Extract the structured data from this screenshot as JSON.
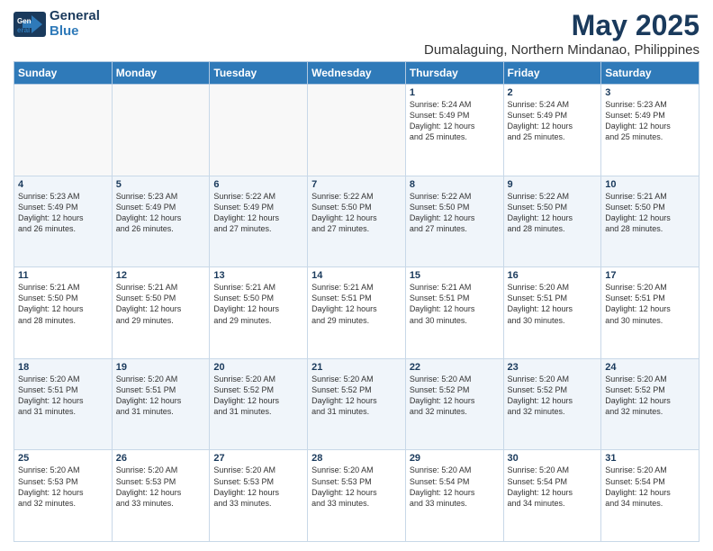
{
  "header": {
    "logo_line1": "General",
    "logo_line2": "Blue",
    "title": "May 2025",
    "subtitle": "Dumalaguing, Northern Mindanao, Philippines"
  },
  "weekdays": [
    "Sunday",
    "Monday",
    "Tuesday",
    "Wednesday",
    "Thursday",
    "Friday",
    "Saturday"
  ],
  "weeks": [
    [
      {
        "day": "",
        "info": ""
      },
      {
        "day": "",
        "info": ""
      },
      {
        "day": "",
        "info": ""
      },
      {
        "day": "",
        "info": ""
      },
      {
        "day": "1",
        "info": "Sunrise: 5:24 AM\nSunset: 5:49 PM\nDaylight: 12 hours\nand 25 minutes."
      },
      {
        "day": "2",
        "info": "Sunrise: 5:24 AM\nSunset: 5:49 PM\nDaylight: 12 hours\nand 25 minutes."
      },
      {
        "day": "3",
        "info": "Sunrise: 5:23 AM\nSunset: 5:49 PM\nDaylight: 12 hours\nand 25 minutes."
      }
    ],
    [
      {
        "day": "4",
        "info": "Sunrise: 5:23 AM\nSunset: 5:49 PM\nDaylight: 12 hours\nand 26 minutes."
      },
      {
        "day": "5",
        "info": "Sunrise: 5:23 AM\nSunset: 5:49 PM\nDaylight: 12 hours\nand 26 minutes."
      },
      {
        "day": "6",
        "info": "Sunrise: 5:22 AM\nSunset: 5:49 PM\nDaylight: 12 hours\nand 27 minutes."
      },
      {
        "day": "7",
        "info": "Sunrise: 5:22 AM\nSunset: 5:50 PM\nDaylight: 12 hours\nand 27 minutes."
      },
      {
        "day": "8",
        "info": "Sunrise: 5:22 AM\nSunset: 5:50 PM\nDaylight: 12 hours\nand 27 minutes."
      },
      {
        "day": "9",
        "info": "Sunrise: 5:22 AM\nSunset: 5:50 PM\nDaylight: 12 hours\nand 28 minutes."
      },
      {
        "day": "10",
        "info": "Sunrise: 5:21 AM\nSunset: 5:50 PM\nDaylight: 12 hours\nand 28 minutes."
      }
    ],
    [
      {
        "day": "11",
        "info": "Sunrise: 5:21 AM\nSunset: 5:50 PM\nDaylight: 12 hours\nand 28 minutes."
      },
      {
        "day": "12",
        "info": "Sunrise: 5:21 AM\nSunset: 5:50 PM\nDaylight: 12 hours\nand 29 minutes."
      },
      {
        "day": "13",
        "info": "Sunrise: 5:21 AM\nSunset: 5:50 PM\nDaylight: 12 hours\nand 29 minutes."
      },
      {
        "day": "14",
        "info": "Sunrise: 5:21 AM\nSunset: 5:51 PM\nDaylight: 12 hours\nand 29 minutes."
      },
      {
        "day": "15",
        "info": "Sunrise: 5:21 AM\nSunset: 5:51 PM\nDaylight: 12 hours\nand 30 minutes."
      },
      {
        "day": "16",
        "info": "Sunrise: 5:20 AM\nSunset: 5:51 PM\nDaylight: 12 hours\nand 30 minutes."
      },
      {
        "day": "17",
        "info": "Sunrise: 5:20 AM\nSunset: 5:51 PM\nDaylight: 12 hours\nand 30 minutes."
      }
    ],
    [
      {
        "day": "18",
        "info": "Sunrise: 5:20 AM\nSunset: 5:51 PM\nDaylight: 12 hours\nand 31 minutes."
      },
      {
        "day": "19",
        "info": "Sunrise: 5:20 AM\nSunset: 5:51 PM\nDaylight: 12 hours\nand 31 minutes."
      },
      {
        "day": "20",
        "info": "Sunrise: 5:20 AM\nSunset: 5:52 PM\nDaylight: 12 hours\nand 31 minutes."
      },
      {
        "day": "21",
        "info": "Sunrise: 5:20 AM\nSunset: 5:52 PM\nDaylight: 12 hours\nand 31 minutes."
      },
      {
        "day": "22",
        "info": "Sunrise: 5:20 AM\nSunset: 5:52 PM\nDaylight: 12 hours\nand 32 minutes."
      },
      {
        "day": "23",
        "info": "Sunrise: 5:20 AM\nSunset: 5:52 PM\nDaylight: 12 hours\nand 32 minutes."
      },
      {
        "day": "24",
        "info": "Sunrise: 5:20 AM\nSunset: 5:52 PM\nDaylight: 12 hours\nand 32 minutes."
      }
    ],
    [
      {
        "day": "25",
        "info": "Sunrise: 5:20 AM\nSunset: 5:53 PM\nDaylight: 12 hours\nand 32 minutes."
      },
      {
        "day": "26",
        "info": "Sunrise: 5:20 AM\nSunset: 5:53 PM\nDaylight: 12 hours\nand 33 minutes."
      },
      {
        "day": "27",
        "info": "Sunrise: 5:20 AM\nSunset: 5:53 PM\nDaylight: 12 hours\nand 33 minutes."
      },
      {
        "day": "28",
        "info": "Sunrise: 5:20 AM\nSunset: 5:53 PM\nDaylight: 12 hours\nand 33 minutes."
      },
      {
        "day": "29",
        "info": "Sunrise: 5:20 AM\nSunset: 5:54 PM\nDaylight: 12 hours\nand 33 minutes."
      },
      {
        "day": "30",
        "info": "Sunrise: 5:20 AM\nSunset: 5:54 PM\nDaylight: 12 hours\nand 34 minutes."
      },
      {
        "day": "31",
        "info": "Sunrise: 5:20 AM\nSunset: 5:54 PM\nDaylight: 12 hours\nand 34 minutes."
      }
    ]
  ]
}
